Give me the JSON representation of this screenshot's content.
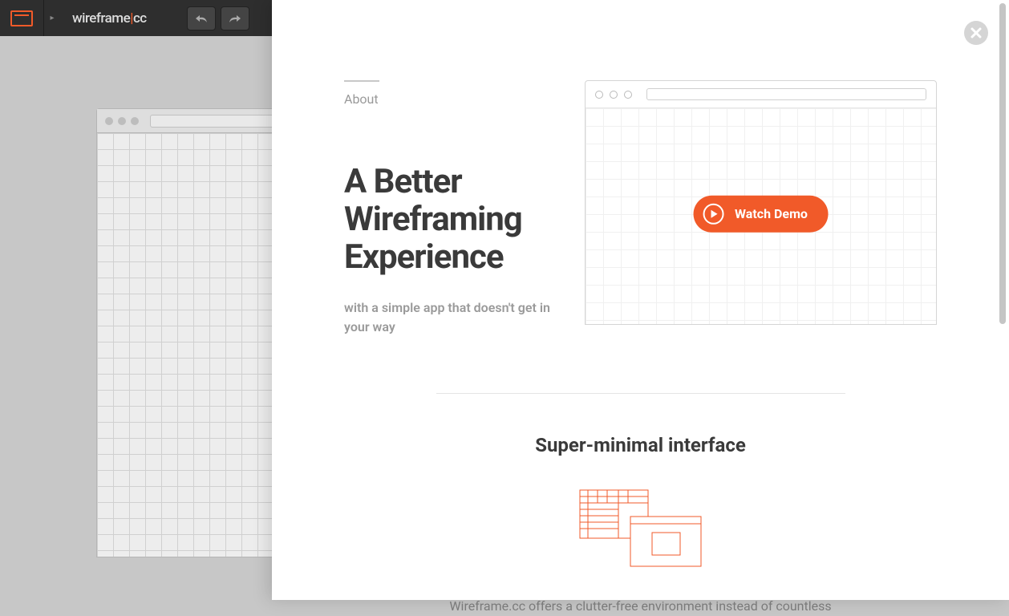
{
  "app": {
    "logo_left": "wireframe",
    "logo_sep": "|",
    "logo_right": "cc"
  },
  "overlay": {
    "about_label": "About",
    "title": "A Better Wireframing Experience",
    "subtitle": "with a simple app that doesn't get in your way",
    "watch_demo": "Watch Demo",
    "section1_title": "Super-minimal interface",
    "section1_body": "Wireframe.cc offers a clutter-free environment instead of countless"
  },
  "colors": {
    "accent": "#F15A29",
    "text_dark": "#3a3a3a",
    "text_muted": "#9a9a9a"
  }
}
